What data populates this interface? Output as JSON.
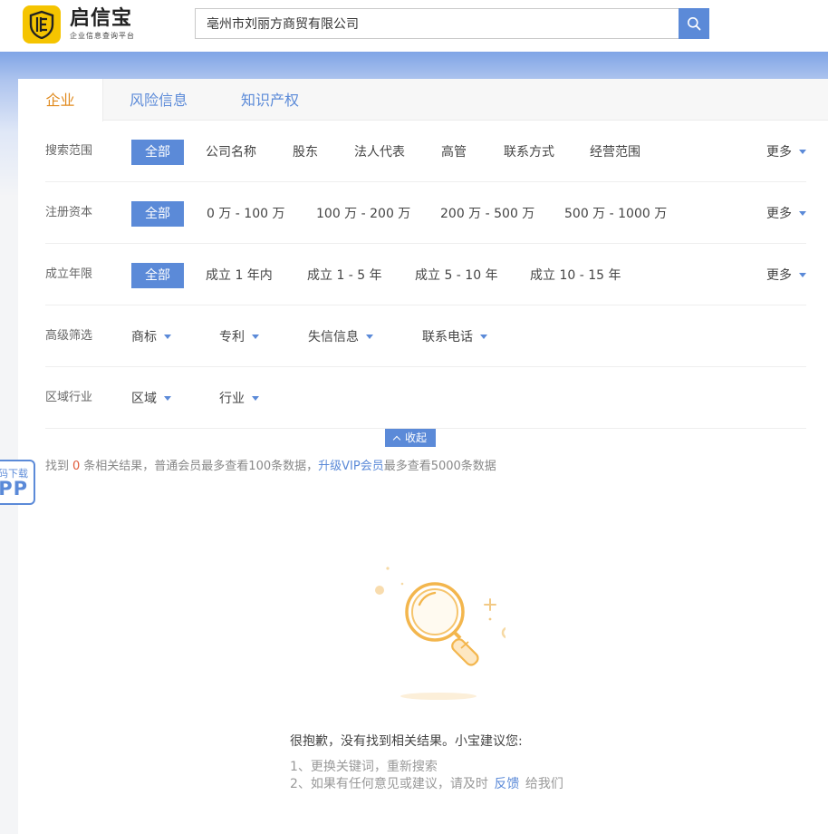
{
  "header": {
    "brand_name": "启信宝",
    "brand_sub": "企业信息查询平台",
    "search_value": "亳州市刘丽方商贸有限公司",
    "search_icon": "search-icon"
  },
  "colors": {
    "accent": "#5b8ad8",
    "orange": "#e08a1e",
    "count": "#e05a3a",
    "logo": "#f5c400"
  },
  "tabs": [
    {
      "label": "企业"
    },
    {
      "label": "风险信息"
    },
    {
      "label": "知识产权"
    }
  ],
  "filters": {
    "more_label": "更多",
    "scope": {
      "label": "搜索范围",
      "options": [
        "全部",
        "公司名称",
        "股东",
        "法人代表",
        "高管",
        "联系方式",
        "经营范围"
      ]
    },
    "capital": {
      "label": "注册资本",
      "options": [
        "全部",
        "0 万 - 100 万",
        "100 万 - 200 万",
        "200 万 - 500 万",
        "500 万 - 1000 万"
      ]
    },
    "age": {
      "label": "成立年限",
      "options": [
        "全部",
        "成立 1 年内",
        "成立 1 - 5 年",
        "成立 5 - 10 年",
        "成立 10 - 15 年"
      ]
    },
    "advanced": {
      "label": "高级筛选",
      "options": [
        "商标",
        "专利",
        "失信信息",
        "联系电话"
      ]
    },
    "region": {
      "label": "区域行业",
      "options": [
        "区域",
        "行业"
      ]
    }
  },
  "collapse_label": "收起",
  "result": {
    "prefix": "找到",
    "count": "0",
    "middle": "条相关结果，普通会员最多查看100条数据，",
    "vip_link": "升级VIP会员",
    "suffix": "最多查看5000条数据"
  },
  "empty": {
    "title": "很抱歉，没有找到相关结果。小宝建议您:",
    "tip1": "1、更换关键词，重新搜索",
    "tip2_prefix": "2、如果有任何意见或建议，请及时",
    "tip2_link": "反馈",
    "tip2_suffix": "给我们"
  },
  "app_badge": {
    "line1": "码下载",
    "line2": "APP"
  }
}
